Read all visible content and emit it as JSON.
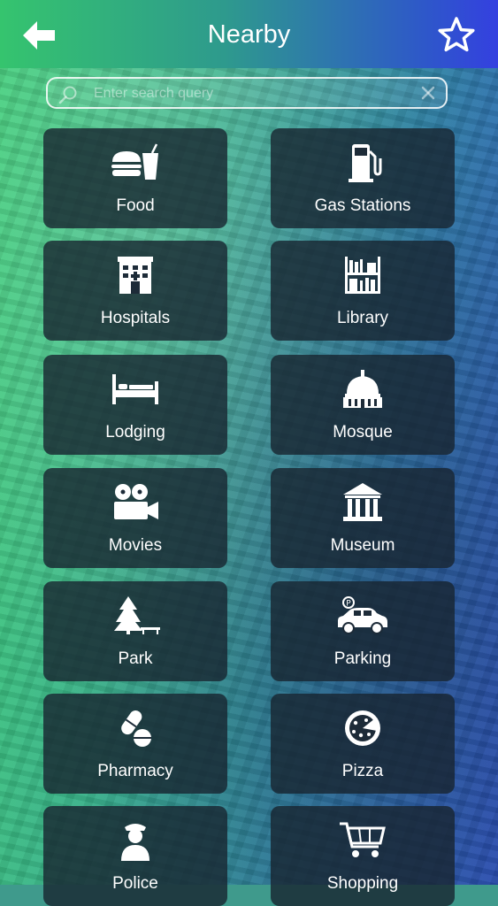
{
  "header": {
    "title": "Nearby"
  },
  "search": {
    "placeholder": "Enter search query",
    "value": ""
  },
  "categories": [
    {
      "label": "Food",
      "icon": "food-icon"
    },
    {
      "label": "Gas Stations",
      "icon": "gas-pump-icon"
    },
    {
      "label": "Hospitals",
      "icon": "hospital-icon"
    },
    {
      "label": "Library",
      "icon": "bookshelf-icon"
    },
    {
      "label": "Lodging",
      "icon": "bed-icon"
    },
    {
      "label": "Mosque",
      "icon": "mosque-icon"
    },
    {
      "label": "Movies",
      "icon": "movie-camera-icon"
    },
    {
      "label": "Museum",
      "icon": "museum-icon"
    },
    {
      "label": "Park",
      "icon": "tree-bench-icon"
    },
    {
      "label": "Parking",
      "icon": "car-parking-icon"
    },
    {
      "label": "Pharmacy",
      "icon": "pills-icon"
    },
    {
      "label": "Pizza",
      "icon": "pizza-icon"
    },
    {
      "label": "Police",
      "icon": "police-officer-icon"
    },
    {
      "label": "Shopping",
      "icon": "shopping-cart-icon"
    }
  ],
  "colors": {
    "header_start": "#35c46e",
    "header_end": "#3440e0",
    "tile_bg": "#182430"
  }
}
